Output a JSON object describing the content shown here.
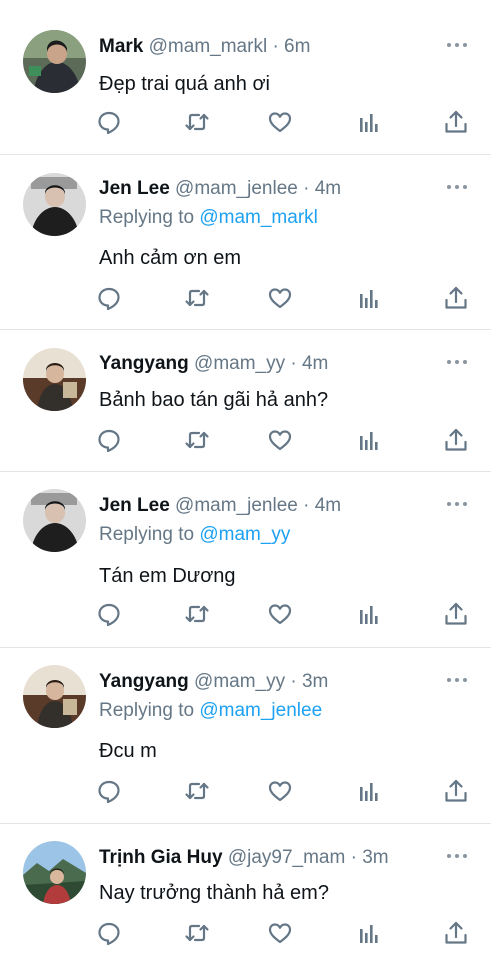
{
  "icons": {
    "reply": "reply-icon",
    "retweet": "retweet-icon",
    "like": "heart-icon",
    "stats": "analytics-icon",
    "share": "share-icon",
    "more": "more-icon"
  },
  "colors": {
    "link": "#1da1f2",
    "meta": "#657786",
    "icon": "#657786",
    "divider": "#e1e5e8"
  },
  "tweets": [
    {
      "name": "Mark",
      "meta": "@mam_markl · 6m",
      "replying_prefix": "",
      "replying_handle": "",
      "text": "Đẹp trai quá anh ơi"
    },
    {
      "name": "Jen Lee",
      "meta": "@mam_jenlee · 4m",
      "replying_prefix": "Replying to ",
      "replying_handle": "@mam_markl",
      "text": "Anh cảm ơn em"
    },
    {
      "name": "Yangyang",
      "meta": "@mam_yy · 4m",
      "replying_prefix": "",
      "replying_handle": "",
      "text": "Bảnh bao tán gãi hả anh?"
    },
    {
      "name": "Jen Lee",
      "meta": "@mam_jenlee · 4m",
      "replying_prefix": "Replying to ",
      "replying_handle": "@mam_yy",
      "text": "Tán em Dương"
    },
    {
      "name": "Yangyang",
      "meta": "@mam_yy · 3m",
      "replying_prefix": "Replying to ",
      "replying_handle": "@mam_jenlee",
      "text": "Đcu m"
    },
    {
      "name": "Trịnh Gia Huy",
      "meta": "@jay97_mam · 3m",
      "replying_prefix": "",
      "replying_handle": "",
      "text": "Nay trưởng thành hả em?"
    }
  ]
}
